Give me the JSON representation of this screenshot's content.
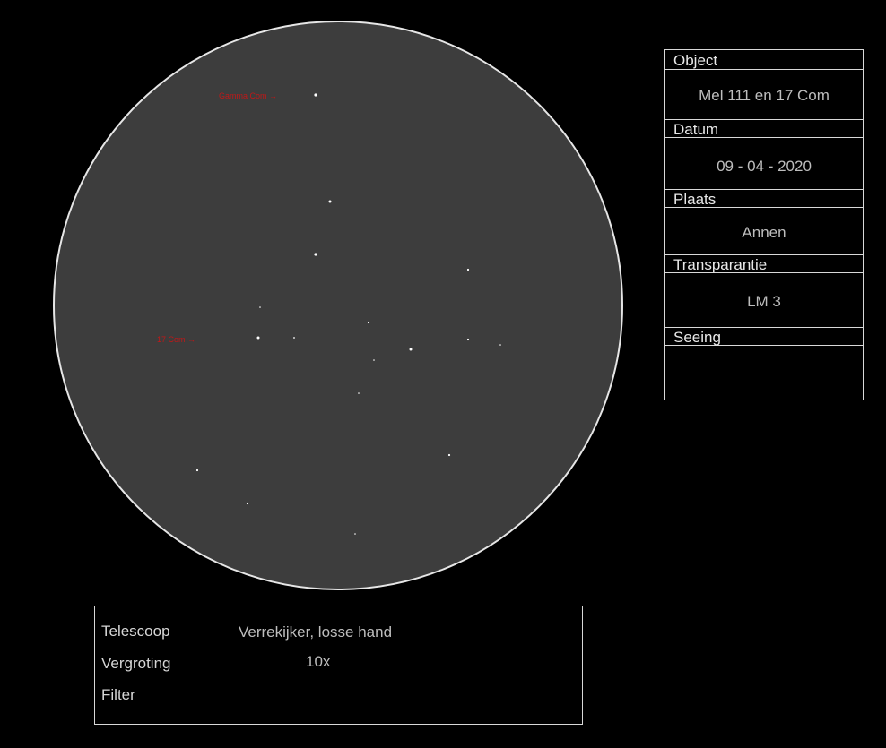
{
  "sketch": {
    "labels": {
      "gamma_com": "Gamma Com →",
      "com17": "17 Com →"
    },
    "colors": {
      "background": "#000000",
      "field": "#3d3d3d",
      "field_edge": "#e6e6e6",
      "annotation": "#c01818",
      "star": "#ffffff"
    }
  },
  "panel": {
    "object_label": "Object",
    "object_value": "Mel 111 en 17 Com",
    "date_label": "Datum",
    "date_value": "09 - 04 - 2020",
    "place_label": "Plaats",
    "place_value": "Annen",
    "transparency_label": "Transparantie",
    "transparency_value": "LM 3",
    "seeing_label": "Seeing",
    "seeing_value": ""
  },
  "info": {
    "telescope_label": "Telescoop",
    "telescope_value": "Verrekijker, losse hand",
    "magnification_label": "Vergroting",
    "magnification_value": "10x",
    "filter_label": "Filter",
    "filter_value": ""
  }
}
